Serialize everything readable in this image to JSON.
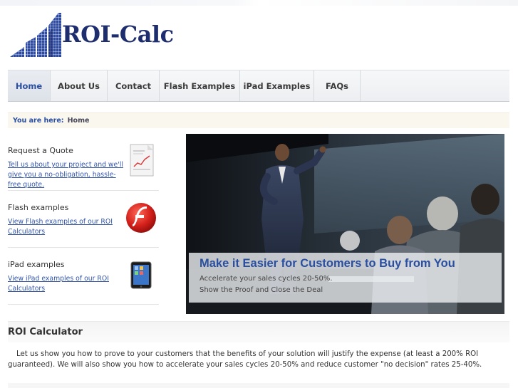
{
  "brand": {
    "name": "ROI-Calc",
    "color": "#1e2d6e"
  },
  "nav": {
    "items": [
      {
        "label": "Home",
        "active": true
      },
      {
        "label": "About Us"
      },
      {
        "label": "Contact"
      },
      {
        "label": "Flash Examples"
      },
      {
        "label": "iPad Examples"
      },
      {
        "label": "FAQs"
      }
    ]
  },
  "breadcrumb": {
    "prefix": "You are here:",
    "current": "Home"
  },
  "sidebar": {
    "items": [
      {
        "title": "Request a Quote",
        "link": "Tell us about your project and we'll give you a no-obligation, hassle-free quote.",
        "icon": "document-chart-icon"
      },
      {
        "title": "Flash examples",
        "link": "View Flash examples of our ROI Calculators",
        "icon": "flash-logo-icon"
      },
      {
        "title": "iPad examples",
        "link": "View iPad examples of our ROI Calculators",
        "icon": "ipad-icon"
      }
    ]
  },
  "banner": {
    "title": "Make it Easier for Customers to Buy from You",
    "lines": [
      "Accelerate your sales cycles 20-50%.",
      "Show the Proof and Close the Deal"
    ]
  },
  "section": {
    "title": "ROI Calculator",
    "body": "Let us show you how to prove to your customers that the benefits of your solution will justify the expense (at least a 200% ROI guaranteed). We will also show you how to accelerate your sales cycles 20-50% and reduce customer \"no decision\" rates 25-40%."
  },
  "colors": {
    "accent": "#2a4fa0",
    "link": "#3355aa",
    "flash_red": "#d3201a"
  }
}
